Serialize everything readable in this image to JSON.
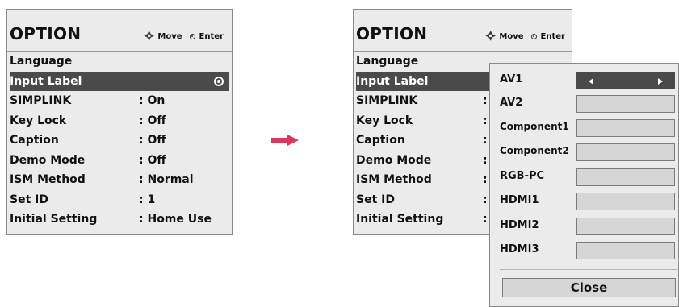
{
  "left_panel": {
    "title": "OPTION",
    "hint_move": "Move",
    "hint_enter": "Enter",
    "items": [
      {
        "label": "Language",
        "value": ""
      },
      {
        "label": "Input Label",
        "value": ""
      },
      {
        "label": "SIMPLINK",
        "value": ": On"
      },
      {
        "label": "Key Lock",
        "value": ": Off"
      },
      {
        "label": "Caption",
        "value": ": Off"
      },
      {
        "label": "Demo Mode",
        "value": ": Off"
      },
      {
        "label": "ISM Method",
        "value": ": Normal"
      },
      {
        "label": "Set ID",
        "value": ": 1"
      },
      {
        "label": "Initial Setting",
        "value": ": Home Use"
      }
    ]
  },
  "right_panel": {
    "title": "OPTION",
    "hint_move": "Move",
    "hint_enter": "Enter",
    "items": [
      {
        "label": "Language",
        "value": ""
      },
      {
        "label": "Input Label",
        "value": ""
      },
      {
        "label": "SIMPLINK",
        "value": ":"
      },
      {
        "label": "Key Lock",
        "value": ":"
      },
      {
        "label": "Caption",
        "value": ":"
      },
      {
        "label": "Demo Mode",
        "value": ":"
      },
      {
        "label": "ISM Method",
        "value": ":"
      },
      {
        "label": "Set ID",
        "value": ":"
      },
      {
        "label": "Initial Setting",
        "value": ":"
      }
    ]
  },
  "popup": {
    "inputs": [
      "AV1",
      "AV2",
      "Component1",
      "Component2",
      "RGB-PC",
      "HDMI1",
      "HDMI2",
      "HDMI3"
    ],
    "close_label": "Close"
  },
  "colors": {
    "arrow": "#d9385f",
    "selected_row": "#4a4a4a",
    "panel_bg": "#ebebeb"
  }
}
